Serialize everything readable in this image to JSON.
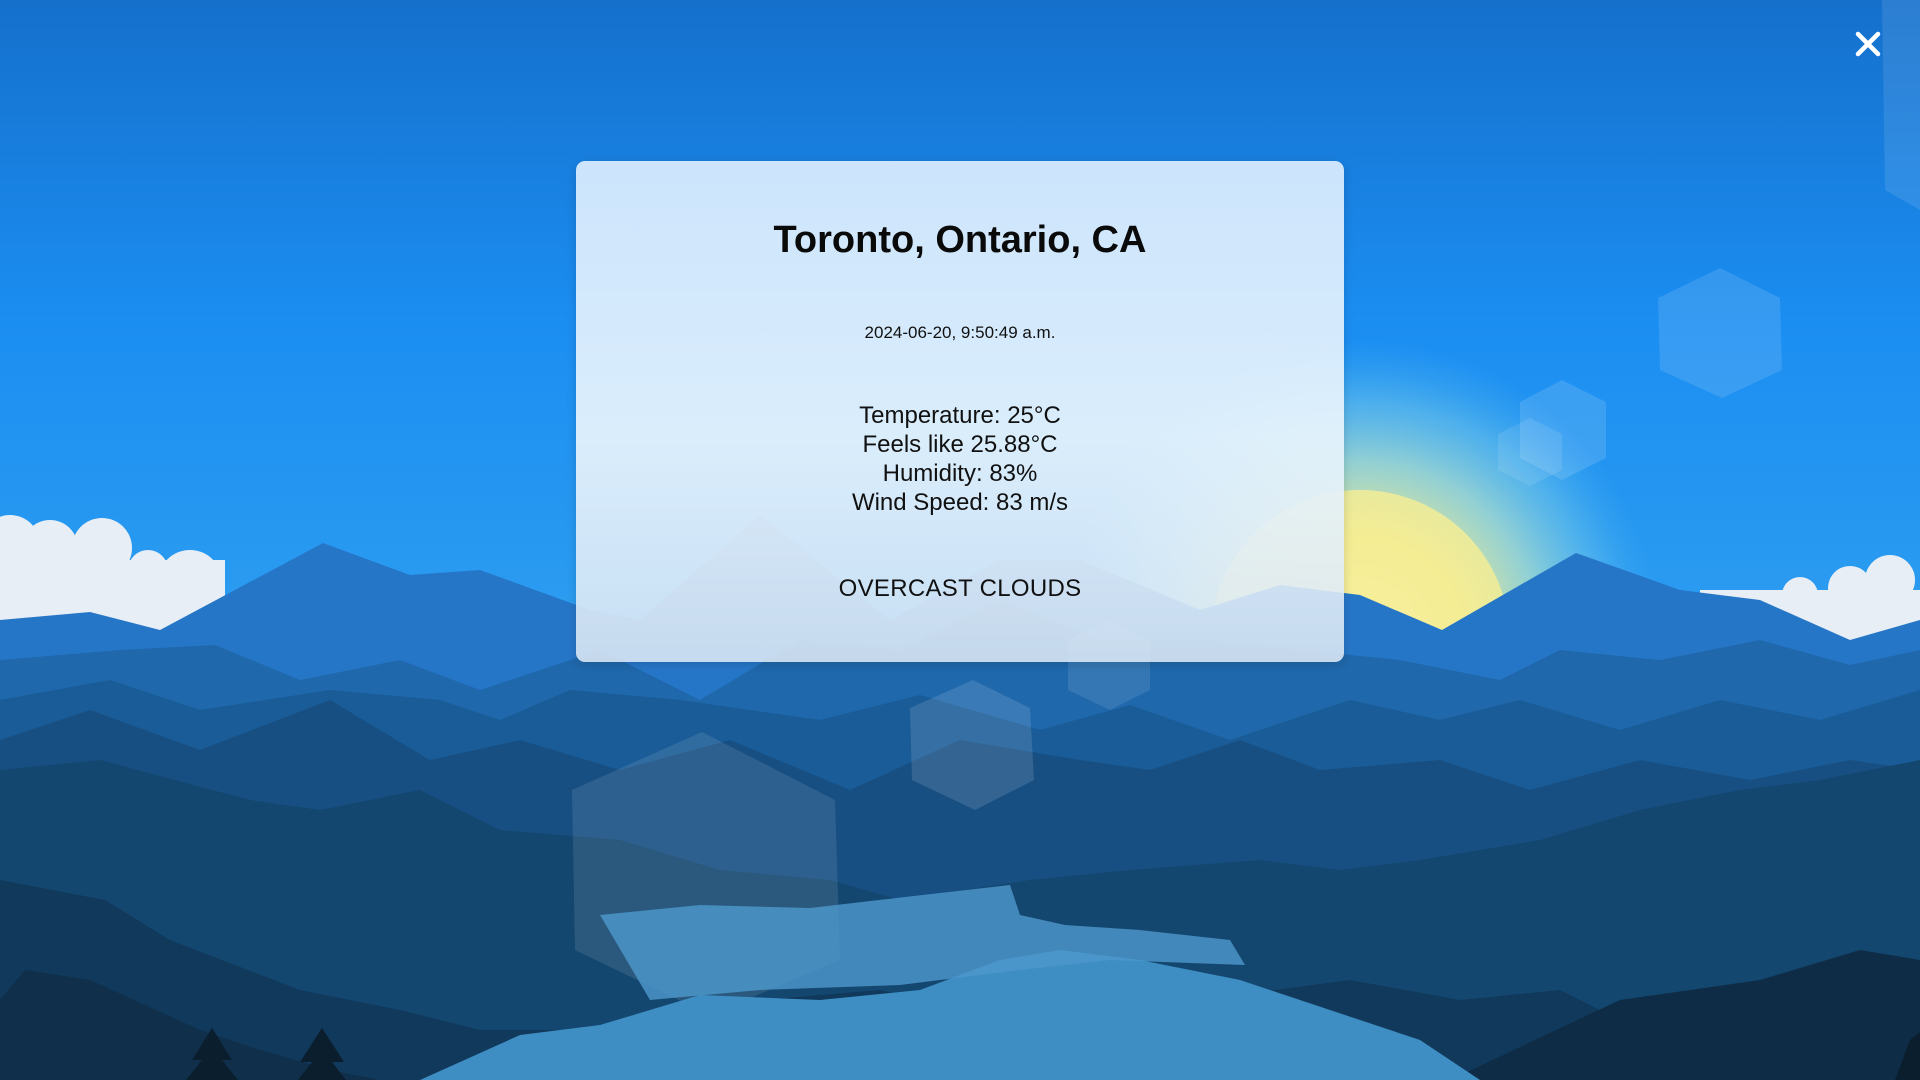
{
  "weather": {
    "location": "Toronto, Ontario, CA",
    "datetime": "2024-06-20, 9:50:49 a.m.",
    "temperature": "Temperature: 25°C",
    "feels_like": "Feels like 25.88°C",
    "humidity": "Humidity: 83%",
    "wind_speed": "Wind Speed: 83 m/s",
    "description": "OVERCAST CLOUDS"
  },
  "controls": {
    "close_icon": "close-icon"
  },
  "colors": {
    "sky_top": "#1a73d0",
    "sky_mid": "#1c8ef0",
    "sun": "#f7ec8f",
    "card_bg": "#dcebfa"
  }
}
